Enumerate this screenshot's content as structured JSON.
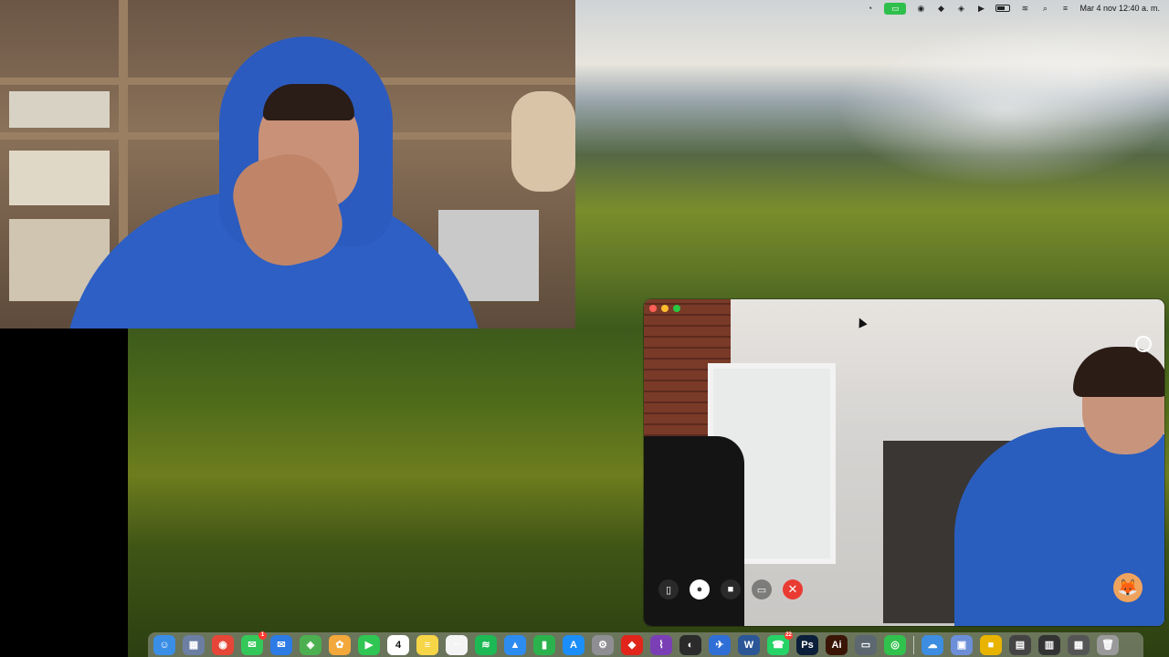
{
  "menubar": {
    "clock": "Mar 4 nov  12:40 a. m.",
    "icons": [
      "creative-cloud-icon",
      "screen-share-icon",
      "record-icon",
      "dropbox-icon",
      "layers-icon",
      "play-icon",
      "battery-icon",
      "wifi-icon",
      "search-icon",
      "control-center-icon"
    ]
  },
  "facetime": {
    "controls": [
      "sidebar-icon",
      "mic-icon",
      "video-icon",
      "share-screen-icon",
      "end-call-icon"
    ]
  },
  "dock": {
    "calendar_day": "4",
    "badges": {
      "messages": "1",
      "whatsapp": "22"
    },
    "apps": [
      {
        "name": "finder",
        "color": "#3a8ee6",
        "glyph": "☺"
      },
      {
        "name": "launchpad",
        "color": "#6c7fa3",
        "glyph": "▦"
      },
      {
        "name": "chrome",
        "color": "#e64637",
        "glyph": "◉"
      },
      {
        "name": "messages",
        "color": "#34c759",
        "glyph": "✉"
      },
      {
        "name": "mail",
        "color": "#2d7be5",
        "glyph": "✉"
      },
      {
        "name": "maps",
        "color": "#4caf50",
        "glyph": "◈"
      },
      {
        "name": "photos",
        "color": "#f3a83b",
        "glyph": "✿"
      },
      {
        "name": "facetime",
        "color": "#30c653",
        "glyph": "▶"
      },
      {
        "name": "calendar",
        "color": "#ffffff",
        "glyph": ""
      },
      {
        "name": "notes",
        "color": "#f6d547",
        "glyph": "≡"
      },
      {
        "name": "freeform",
        "color": "#f4f4f4",
        "glyph": "~"
      },
      {
        "name": "spotify",
        "color": "#1db954",
        "glyph": "≋"
      },
      {
        "name": "keynote",
        "color": "#2d8cf0",
        "glyph": "▲"
      },
      {
        "name": "numbers",
        "color": "#2bb24c",
        "glyph": "▮"
      },
      {
        "name": "app-store",
        "color": "#1c8ef9",
        "glyph": "A"
      },
      {
        "name": "system-settings",
        "color": "#8e8e93",
        "glyph": "⚙"
      },
      {
        "name": "acrobat",
        "color": "#e1251b",
        "glyph": "◆"
      },
      {
        "name": "tor",
        "color": "#7b3fb5",
        "glyph": "⌇"
      },
      {
        "name": "activity-monitor",
        "color": "#2b2b2b",
        "glyph": "◐"
      },
      {
        "name": "xcode-sim",
        "color": "#2f6fd6",
        "glyph": "✈"
      },
      {
        "name": "word",
        "color": "#2b5797",
        "glyph": "W"
      },
      {
        "name": "whatsapp",
        "color": "#25d366",
        "glyph": "☎"
      },
      {
        "name": "photoshop",
        "color": "#0b1f3a",
        "glyph": "Ps"
      },
      {
        "name": "illustrator",
        "color": "#3a1505",
        "glyph": "Ai"
      },
      {
        "name": "screen-capture",
        "color": "#5c6770",
        "glyph": "▭"
      },
      {
        "name": "zoom-green",
        "color": "#31c24d",
        "glyph": "◎"
      }
    ],
    "trailing": [
      {
        "name": "onedrive",
        "color": "#3d8de0",
        "glyph": "☁"
      },
      {
        "name": "preview",
        "color": "#6c8fd8",
        "glyph": "▣"
      },
      {
        "name": "stack-1",
        "color": "#e8b400",
        "glyph": "■"
      },
      {
        "name": "stack-2",
        "color": "#444",
        "glyph": "▤"
      },
      {
        "name": "stack-3",
        "color": "#333",
        "glyph": "▥"
      },
      {
        "name": "stack-4",
        "color": "#555",
        "glyph": "▦"
      },
      {
        "name": "trash",
        "color": "#9a9a9a",
        "glyph": "🗑"
      }
    ]
  }
}
